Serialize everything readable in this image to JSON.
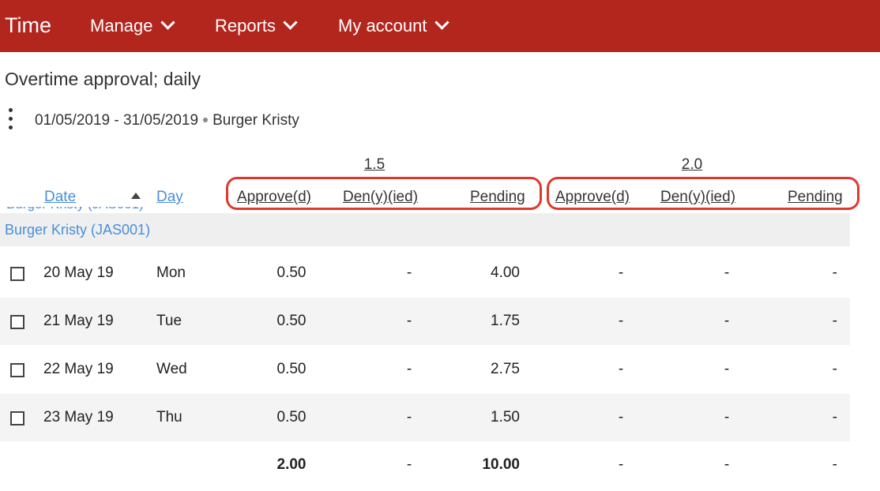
{
  "nav": {
    "brand": "Time",
    "items": [
      {
        "label": "Manage"
      },
      {
        "label": "Reports"
      },
      {
        "label": "My account"
      }
    ]
  },
  "page": {
    "title": "Overtime approval; daily",
    "date_range": "01/05/2019 - 31/05/2019",
    "employee_filter": "Burger Kristy"
  },
  "table": {
    "groups": [
      "1.5",
      "2.0"
    ],
    "columns": {
      "date": "Date",
      "day": "Day",
      "approved": "Approve(d)",
      "denied": "Den(y)(ied)",
      "pending": "Pending"
    },
    "sort": "ascending",
    "group_row": {
      "label": "Burger Kristy (JAS001)"
    },
    "rows": [
      {
        "date": "20 May 19",
        "day": "Mon",
        "a15": "0.50",
        "d15": "-",
        "p15": "4.00",
        "a20": "-",
        "d20": "-",
        "p20": "-"
      },
      {
        "date": "21 May 19",
        "day": "Tue",
        "a15": "0.50",
        "d15": "-",
        "p15": "1.75",
        "a20": "-",
        "d20": "-",
        "p20": "-"
      },
      {
        "date": "22 May 19",
        "day": "Wed",
        "a15": "0.50",
        "d15": "-",
        "p15": "2.75",
        "a20": "-",
        "d20": "-",
        "p20": "-"
      },
      {
        "date": "23 May 19",
        "day": "Thu",
        "a15": "0.50",
        "d15": "-",
        "p15": "1.50",
        "a20": "-",
        "d20": "-",
        "p20": "-"
      }
    ],
    "totals": {
      "a15": "2.00",
      "d15": "-",
      "p15": "10.00",
      "a20": "-",
      "d20": "-",
      "p20": "-"
    }
  },
  "colors": {
    "brand_red": "#b3261e",
    "link_blue": "#4a8fd9",
    "highlight_red": "#e0392b"
  }
}
